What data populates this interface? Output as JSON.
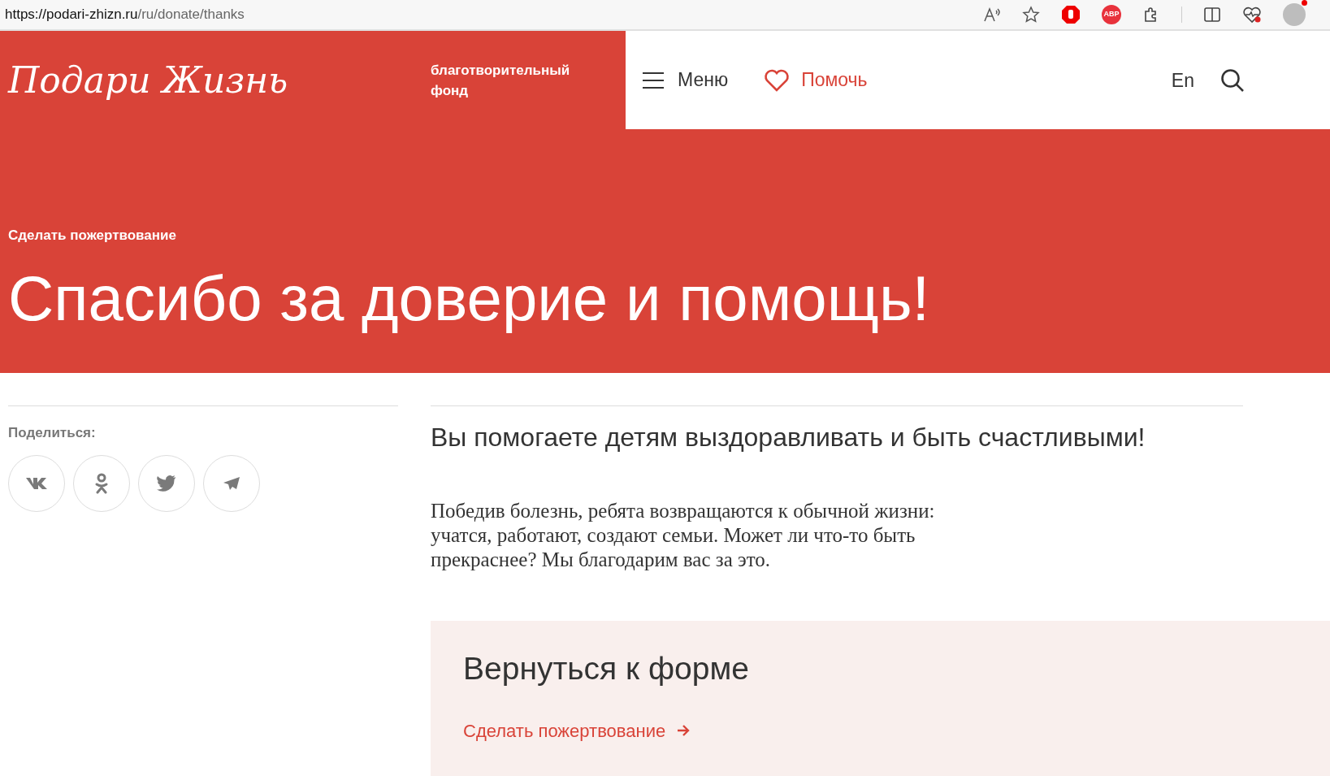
{
  "browser": {
    "url_host": "https://podari-zhizn.ru",
    "url_path": "/ru/donate/thanks",
    "extension_badge": "ABP"
  },
  "header": {
    "logo": "Подари Жизнь",
    "tagline": "благотворительный фонд",
    "menu": "Меню",
    "help": "Помочь",
    "language": "En"
  },
  "hero": {
    "breadcrumb": "Сделать пожертвование",
    "title": "Спасибо за доверие и помощь!"
  },
  "share": {
    "label": "Поделиться:",
    "networks": [
      {
        "kind": "vk"
      },
      {
        "kind": "ok"
      },
      {
        "kind": "twitter"
      },
      {
        "kind": "telegram"
      }
    ]
  },
  "content": {
    "heading": "Вы помогаете детям выздоравливать и быть счастливыми!",
    "paragraph": "Победив болезнь, ребята возвращаются к обычной жизни: учатся, работают, создают семьи. Может ли что-то быть прекраснее? Мы благодарим вас за это."
  },
  "return_box": {
    "title": "Вернуться к форме",
    "link": "Сделать пожертвование"
  }
}
